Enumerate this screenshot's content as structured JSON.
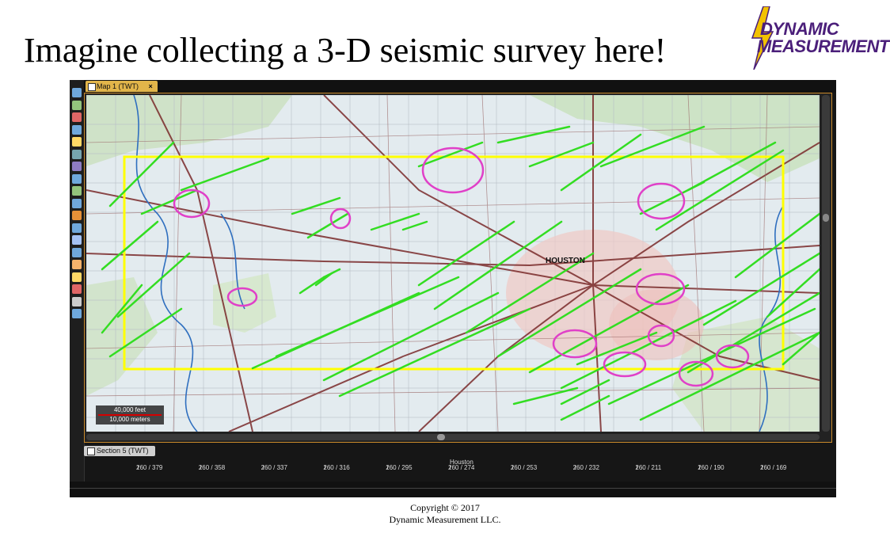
{
  "slide": {
    "title": "Imagine collecting a 3-D seismic survey here!"
  },
  "logo": {
    "line1": "DYNAMIC",
    "line2": "MEASUREMENT",
    "bolt_color": "#f2c200",
    "text_color": "#4b1f7a"
  },
  "app": {
    "map_tab": {
      "label": "Map 1 (TWT)",
      "close": "×"
    },
    "section_tab": {
      "label": "Section 5 (TWT)"
    },
    "map": {
      "city_label": "HOUSTON",
      "scale_feet": "40,000 feet",
      "scale_meters": "10,000 meters",
      "survey_outline_color": "#ffff00",
      "fault_color": "#33dd22",
      "anomaly_color": "#e040c8"
    },
    "ruler": {
      "title": "Houston",
      "ticks": [
        "260 / 379",
        "260 / 358",
        "260 / 337",
        "260 / 316",
        "260 / 295",
        "260 / 274",
        "260 / 253",
        "260 / 232",
        "260 / 211",
        "260 / 190",
        "260 / 169"
      ]
    },
    "toolbar_icons": [
      "pan-icon",
      "zoom-icon",
      "select-icon",
      "rotate-icon",
      "measure-icon",
      "grid-icon",
      "info-icon",
      "layers-icon",
      "draw-icon",
      "fault-icon",
      "horizon-icon",
      "well-icon",
      "chart-icon",
      "polygon-icon",
      "cube-icon",
      "color-icon",
      "legend-icon",
      "settings-icon",
      "frame-icon"
    ]
  },
  "footer": {
    "copyright_line1": "Copyright © 2017",
    "copyright_line2": "Dynamic Measurement LLC."
  }
}
